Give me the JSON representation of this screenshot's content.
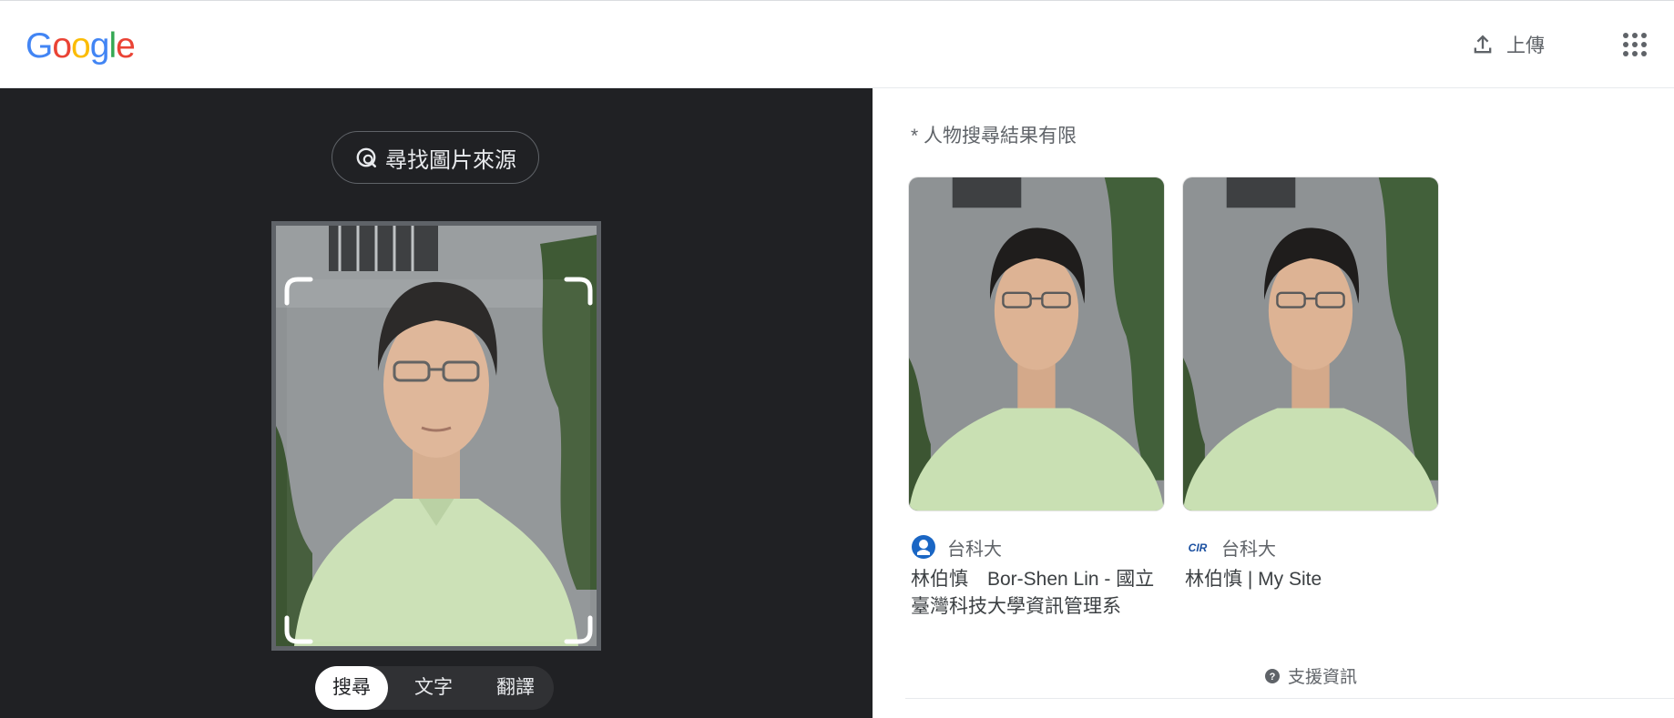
{
  "header": {
    "logo": {
      "letters": [
        "G",
        "o",
        "o",
        "g",
        "l",
        "e"
      ],
      "colors": [
        "#4285F4",
        "#EA4335",
        "#FBBC05",
        "#4285F4",
        "#34A853",
        "#EA4335"
      ]
    },
    "upload_label": "上傳",
    "upload_icon": "upload-icon",
    "apps_icon": "apps-grid-icon"
  },
  "left": {
    "find_source_label": "尋找圖片來源",
    "find_source_icon": "lens-search-icon",
    "tabs": [
      {
        "label": "搜尋",
        "active": true
      },
      {
        "label": "文字",
        "active": false
      },
      {
        "label": "翻譯",
        "active": false
      }
    ]
  },
  "right": {
    "note": "* 人物搜尋結果有限",
    "results": [
      {
        "source": "台科大",
        "source_icon": "ntust-logo-icon",
        "title": "林伯慎　Bor-Shen Lin - 國立臺灣科技大學資訊管理系"
      },
      {
        "source": "台科大",
        "source_icon": "cir-logo-icon",
        "title": "林伯慎 | My Site"
      }
    ],
    "support_label": "支援資訊",
    "support_icon": "help-icon"
  },
  "colors": {
    "accent_blue": "#1a73e8",
    "dark_bg": "#202124"
  }
}
